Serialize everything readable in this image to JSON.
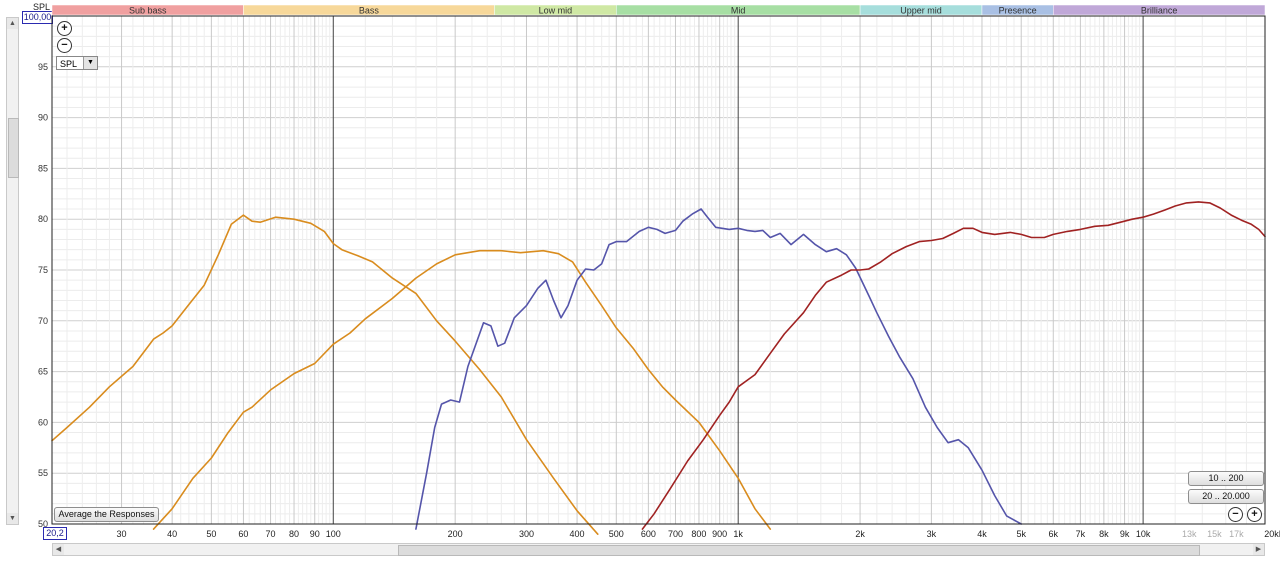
{
  "header": {
    "y_unit_label": "SPL",
    "y_max_box": "100,00",
    "x_min_box": "20,2"
  },
  "controls": {
    "zoom_in_icon": "zoom-in-icon",
    "zoom_out_icon": "zoom-out-icon",
    "measure_select": "SPL",
    "avg_button": "Average the Responses",
    "range_btn_1": "10 .. 200",
    "range_btn_2": "20 .. 20.000"
  },
  "bands": [
    {
      "label": "Sub bass",
      "from": 20,
      "to": 60,
      "color": "#f0a0a0"
    },
    {
      "label": "Bass",
      "from": 60,
      "to": 250,
      "color": "#f7d89a"
    },
    {
      "label": "Low mid",
      "from": 250,
      "to": 500,
      "color": "#cfe8a4"
    },
    {
      "label": "Mid",
      "from": 500,
      "to": 2000,
      "color": "#a7dfa4"
    },
    {
      "label": "Upper mid",
      "from": 2000,
      "to": 4000,
      "color": "#a6dedc"
    },
    {
      "label": "Presence",
      "from": 4000,
      "to": 6000,
      "color": "#a9c0e4"
    },
    {
      "label": "Brilliance",
      "from": 6000,
      "to": 20000,
      "color": "#c0a8d8"
    }
  ],
  "chart_data": {
    "type": "line",
    "xscale": "log",
    "xlim": [
      20.2,
      20000
    ],
    "ylim": [
      50,
      100
    ],
    "ylabel": "SPL",
    "grid": true,
    "yticks": [
      50,
      55,
      60,
      65,
      70,
      75,
      80,
      85,
      90,
      95
    ],
    "xticks": [
      {
        "v": 30,
        "t": "30"
      },
      {
        "v": 40,
        "t": "40"
      },
      {
        "v": 50,
        "t": "50"
      },
      {
        "v": 60,
        "t": "60"
      },
      {
        "v": 70,
        "t": "70"
      },
      {
        "v": 80,
        "t": "80"
      },
      {
        "v": 90,
        "t": "90"
      },
      {
        "v": 100,
        "t": "100"
      },
      {
        "v": 200,
        "t": "200"
      },
      {
        "v": 300,
        "t": "300"
      },
      {
        "v": 400,
        "t": "400"
      },
      {
        "v": 500,
        "t": "500"
      },
      {
        "v": 600,
        "t": "600"
      },
      {
        "v": 700,
        "t": "700"
      },
      {
        "v": 800,
        "t": "800"
      },
      {
        "v": 900,
        "t": "900"
      },
      {
        "v": 1000,
        "t": "1k"
      },
      {
        "v": 2000,
        "t": "2k"
      },
      {
        "v": 3000,
        "t": "3k"
      },
      {
        "v": 4000,
        "t": "4k"
      },
      {
        "v": 5000,
        "t": "5k"
      },
      {
        "v": 6000,
        "t": "6k"
      },
      {
        "v": 7000,
        "t": "7k"
      },
      {
        "v": 8000,
        "t": "8k"
      },
      {
        "v": 9000,
        "t": "9k"
      },
      {
        "v": 10000,
        "t": "10k"
      },
      {
        "v": 13000,
        "t": "13k",
        "faded": true
      },
      {
        "v": 15000,
        "t": "15k",
        "faded": true
      },
      {
        "v": 17000,
        "t": "17k",
        "faded": true
      },
      {
        "v": 20000,
        "t": "20kHz"
      }
    ],
    "series": [
      {
        "color": "#d98c1e",
        "points": [
          [
            20.2,
            58.2
          ],
          [
            22,
            59.5
          ],
          [
            25,
            61.5
          ],
          [
            28,
            63.5
          ],
          [
            32,
            65.5
          ],
          [
            36,
            68.2
          ],
          [
            38,
            68.8
          ],
          [
            40,
            69.5
          ],
          [
            44,
            71.6
          ],
          [
            48,
            73.5
          ],
          [
            52,
            76.5
          ],
          [
            56,
            79.5
          ],
          [
            60,
            80.4
          ],
          [
            63,
            79.8
          ],
          [
            66,
            79.7
          ],
          [
            72,
            80.2
          ],
          [
            80,
            80
          ],
          [
            88,
            79.6
          ],
          [
            95,
            78.8
          ],
          [
            100,
            77.6
          ],
          [
            105,
            77
          ],
          [
            115,
            76.4
          ],
          [
            125,
            75.8
          ],
          [
            140,
            74.2
          ],
          [
            160,
            72.7
          ],
          [
            180,
            70
          ],
          [
            200,
            68
          ],
          [
            230,
            65.2
          ],
          [
            260,
            62.5
          ],
          [
            300,
            58.3
          ],
          [
            350,
            54.5
          ],
          [
            400,
            51.3
          ],
          [
            450,
            49
          ]
        ]
      },
      {
        "color": "#d98c1e",
        "points": [
          [
            36,
            49.5
          ],
          [
            40,
            51.5
          ],
          [
            45,
            54.5
          ],
          [
            50,
            56.5
          ],
          [
            55,
            59
          ],
          [
            60,
            61
          ],
          [
            63,
            61.5
          ],
          [
            70,
            63.2
          ],
          [
            80,
            64.8
          ],
          [
            90,
            65.8
          ],
          [
            100,
            67.7
          ],
          [
            110,
            68.8
          ],
          [
            120,
            70.2
          ],
          [
            140,
            72.2
          ],
          [
            160,
            74.2
          ],
          [
            180,
            75.6
          ],
          [
            200,
            76.5
          ],
          [
            230,
            76.9
          ],
          [
            260,
            76.9
          ],
          [
            290,
            76.7
          ],
          [
            330,
            76.9
          ],
          [
            360,
            76.6
          ],
          [
            390,
            75.8
          ],
          [
            420,
            73.8
          ],
          [
            460,
            71.5
          ],
          [
            500,
            69.3
          ],
          [
            550,
            67.3
          ],
          [
            600,
            65.2
          ],
          [
            650,
            63.5
          ],
          [
            700,
            62.2
          ],
          [
            800,
            60
          ],
          [
            900,
            57.2
          ],
          [
            1000,
            54.5
          ],
          [
            1100,
            51.5
          ],
          [
            1200,
            49.5
          ]
        ]
      },
      {
        "color": "#5555aa",
        "points": [
          [
            160,
            49.5
          ],
          [
            170,
            55
          ],
          [
            178,
            59.5
          ],
          [
            185,
            61.8
          ],
          [
            195,
            62.2
          ],
          [
            205,
            62
          ],
          [
            215,
            65.5
          ],
          [
            235,
            69.8
          ],
          [
            245,
            69.5
          ],
          [
            255,
            67.5
          ],
          [
            265,
            67.8
          ],
          [
            280,
            70.3
          ],
          [
            300,
            71.5
          ],
          [
            320,
            73.2
          ],
          [
            335,
            74
          ],
          [
            350,
            72
          ],
          [
            365,
            70.3
          ],
          [
            380,
            71.5
          ],
          [
            400,
            74
          ],
          [
            420,
            75.1
          ],
          [
            440,
            75
          ],
          [
            460,
            75.6
          ],
          [
            480,
            77.5
          ],
          [
            500,
            77.8
          ],
          [
            530,
            77.8
          ],
          [
            570,
            78.8
          ],
          [
            600,
            79.2
          ],
          [
            630,
            79
          ],
          [
            660,
            78.6
          ],
          [
            700,
            78.9
          ],
          [
            730,
            79.8
          ],
          [
            770,
            80.5
          ],
          [
            810,
            81
          ],
          [
            840,
            80.2
          ],
          [
            880,
            79.2
          ],
          [
            950,
            79
          ],
          [
            1000,
            79.1
          ],
          [
            1050,
            78.9
          ],
          [
            1100,
            78.8
          ],
          [
            1150,
            78.9
          ],
          [
            1200,
            78.2
          ],
          [
            1270,
            78.6
          ],
          [
            1350,
            77.5
          ],
          [
            1450,
            78.5
          ],
          [
            1550,
            77.5
          ],
          [
            1650,
            76.8
          ],
          [
            1750,
            77.1
          ],
          [
            1850,
            76.5
          ],
          [
            1950,
            75.2
          ],
          [
            2100,
            72.5
          ],
          [
            2200,
            70.8
          ],
          [
            2350,
            68.5
          ],
          [
            2500,
            66.5
          ],
          [
            2700,
            64.3
          ],
          [
            2900,
            61.5
          ],
          [
            3100,
            59.5
          ],
          [
            3300,
            58
          ],
          [
            3500,
            58.3
          ],
          [
            3700,
            57.5
          ],
          [
            4000,
            55.3
          ],
          [
            4300,
            52.8
          ],
          [
            4600,
            50.8
          ],
          [
            5000,
            50
          ]
        ]
      },
      {
        "color": "#a02222",
        "points": [
          [
            580,
            49.5
          ],
          [
            620,
            51
          ],
          [
            680,
            53.5
          ],
          [
            750,
            56.2
          ],
          [
            820,
            58.3
          ],
          [
            900,
            60.7
          ],
          [
            950,
            62
          ],
          [
            1000,
            63.5
          ],
          [
            1100,
            64.7
          ],
          [
            1200,
            66.8
          ],
          [
            1300,
            68.7
          ],
          [
            1450,
            70.8
          ],
          [
            1550,
            72.5
          ],
          [
            1650,
            73.8
          ],
          [
            1800,
            74.5
          ],
          [
            1900,
            75
          ],
          [
            2000,
            75
          ],
          [
            2100,
            75.1
          ],
          [
            2250,
            75.8
          ],
          [
            2400,
            76.6
          ],
          [
            2600,
            77.3
          ],
          [
            2800,
            77.8
          ],
          [
            3000,
            77.9
          ],
          [
            3200,
            78.1
          ],
          [
            3400,
            78.6
          ],
          [
            3600,
            79.1
          ],
          [
            3800,
            79.1
          ],
          [
            4000,
            78.7
          ],
          [
            4300,
            78.5
          ],
          [
            4700,
            78.7
          ],
          [
            5000,
            78.5
          ],
          [
            5300,
            78.2
          ],
          [
            5700,
            78.2
          ],
          [
            6000,
            78.5
          ],
          [
            6500,
            78.8
          ],
          [
            7000,
            79
          ],
          [
            7600,
            79.3
          ],
          [
            8200,
            79.4
          ],
          [
            8800,
            79.7
          ],
          [
            9400,
            80
          ],
          [
            10000,
            80.2
          ],
          [
            10600,
            80.5
          ],
          [
            11300,
            80.9
          ],
          [
            12000,
            81.3
          ],
          [
            12800,
            81.6
          ],
          [
            13700,
            81.7
          ],
          [
            14600,
            81.6
          ],
          [
            15500,
            81.1
          ],
          [
            16500,
            80.4
          ],
          [
            17500,
            79.9
          ],
          [
            18500,
            79.5
          ],
          [
            19300,
            79
          ],
          [
            20000,
            78.3
          ]
        ]
      }
    ]
  }
}
